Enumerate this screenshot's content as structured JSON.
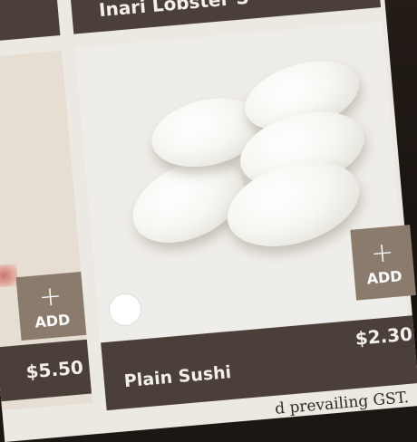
{
  "header": {
    "title": "Inari Lobster S"
  },
  "main_item": {
    "name": "Plain Sushi",
    "price": "$2.30",
    "add_label": "ADD",
    "add_symbol": "+"
  },
  "left_item": {
    "price": "$5.50",
    "add_label": "ADD",
    "add_symbol": "+"
  },
  "footer": {
    "note": "d prevailing GST."
  },
  "colors": {
    "dark_bar": "#4a4039",
    "add_button": "#8a7b6c",
    "screen_bg": "#ece8e2"
  }
}
